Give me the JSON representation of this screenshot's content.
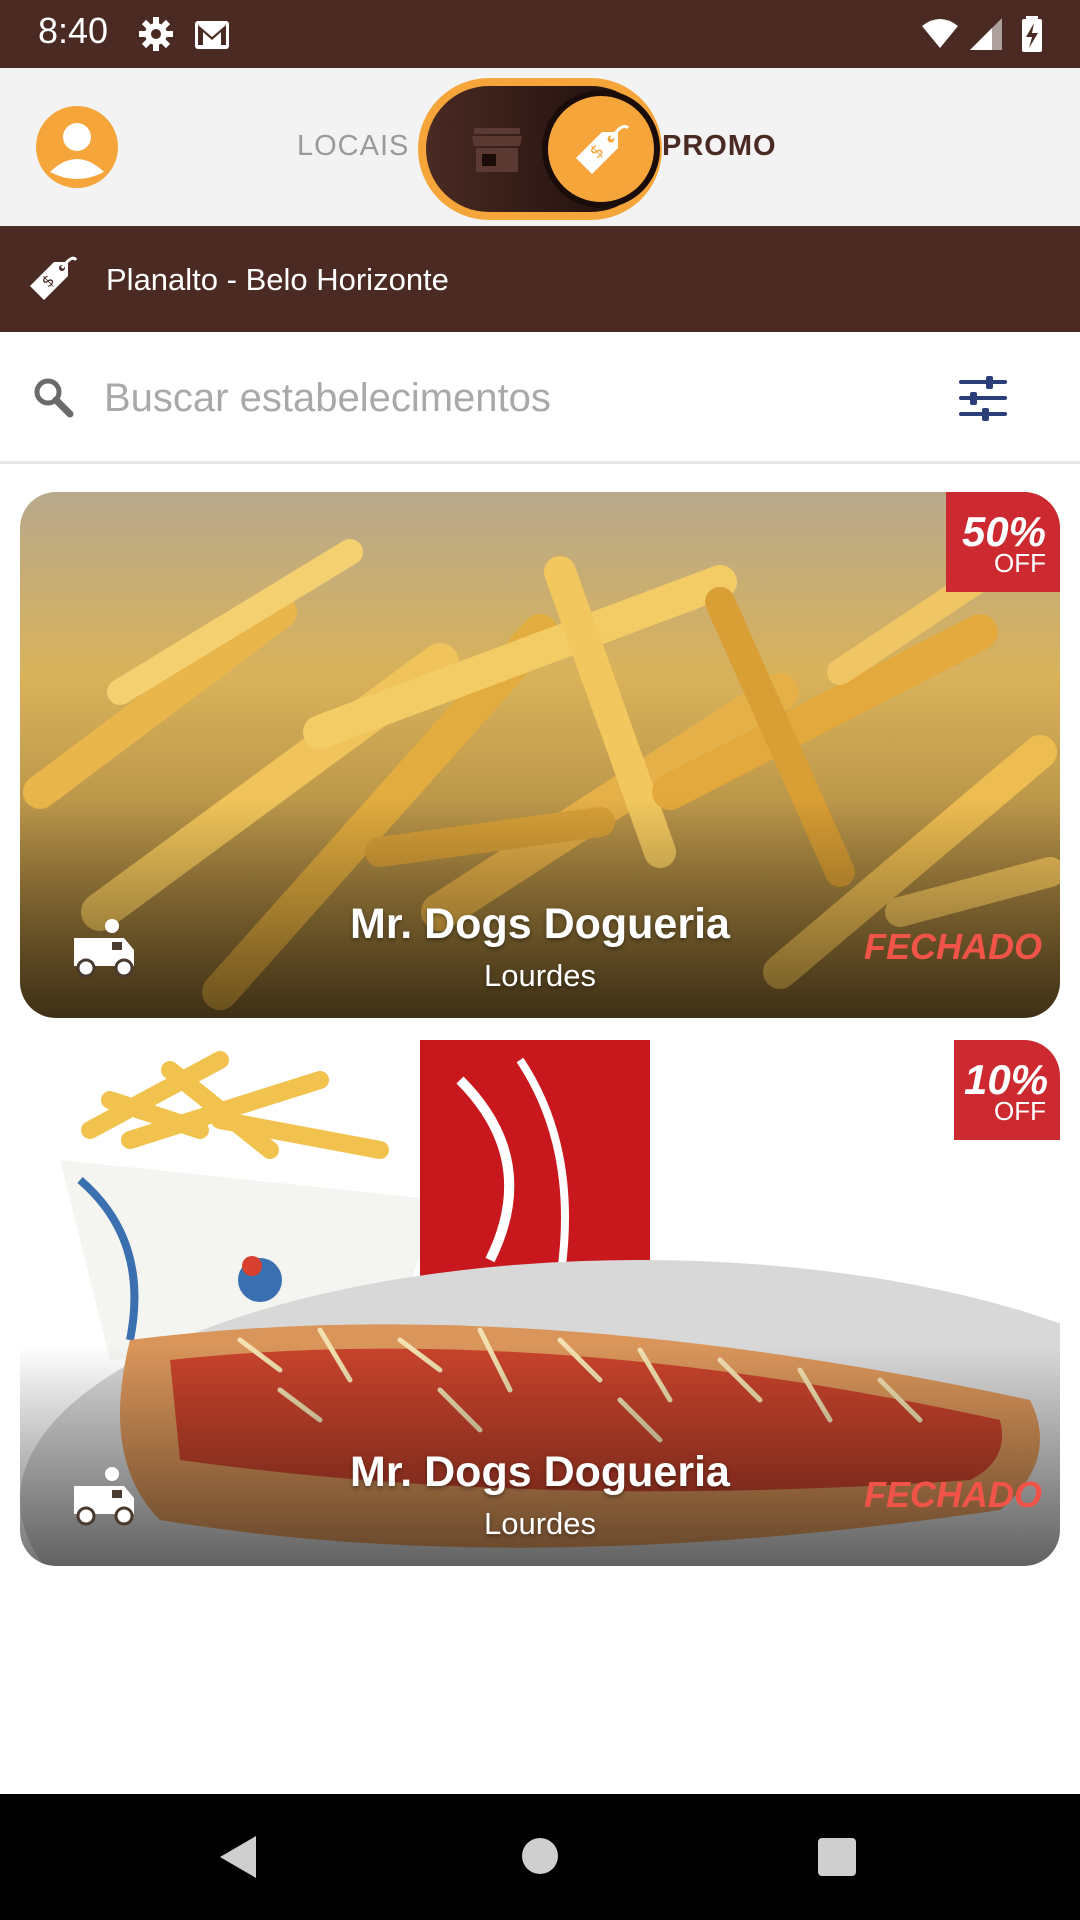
{
  "status_bar": {
    "time": "8:40",
    "icons": [
      "settings-icon",
      "gmail-icon",
      "wifi-icon",
      "signal-icon",
      "battery-icon"
    ]
  },
  "header": {
    "tab_locais": "LOCAIS",
    "tab_promo": "PROMO",
    "toggle_state": "promo",
    "colors": {
      "accent": "#f5a53a",
      "brand_dark": "#4a2a23"
    }
  },
  "location": {
    "label": "Planalto - Belo Horizonte"
  },
  "search": {
    "placeholder": "Buscar estabelecimentos"
  },
  "cards": [
    {
      "discount_pct": "50%",
      "discount_off": "OFF",
      "name": "Mr. Dogs Dogueria",
      "neighborhood": "Lourdes",
      "status": "FECHADO",
      "image": "french-fries"
    },
    {
      "discount_pct": "10%",
      "discount_off": "OFF",
      "name": "Mr. Dogs Dogueria",
      "neighborhood": "Lourdes",
      "status": "FECHADO",
      "image": "hotdog-combo"
    }
  ]
}
